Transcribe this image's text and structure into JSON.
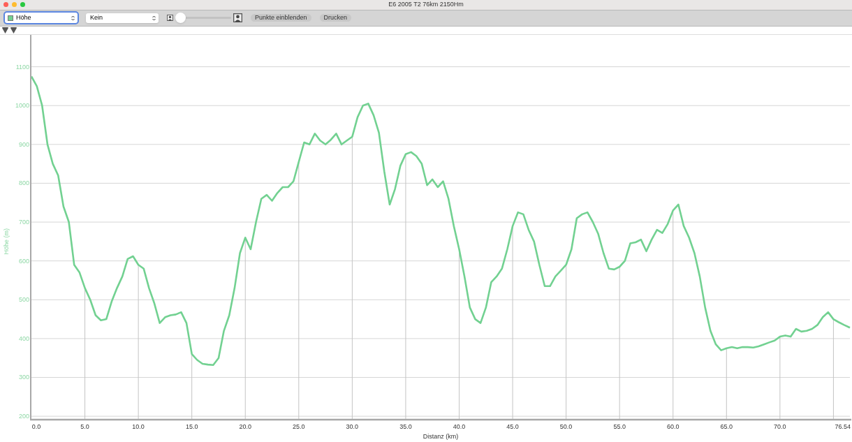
{
  "window": {
    "title": "E6 2005 T2 76km 2150Hm"
  },
  "toolbar": {
    "overlay_select": {
      "value": "Kein"
    },
    "zoom_slider": {
      "level": 0
    },
    "buttons": [
      "Punkte einblenden",
      "Drucken"
    ]
  },
  "chart": {
    "chart_data": {
      "type": "line",
      "grid": true,
      "ref_lines": [
        {
          "axis": "x",
          "value": 5
        },
        {
          "axis": "x",
          "value": 10
        },
        {
          "axis": "x",
          "value": 15
        },
        {
          "axis": "x",
          "value": 20
        },
        {
          "axis": "x",
          "value": 25
        },
        {
          "axis": "x",
          "value": 30
        },
        {
          "axis": "x",
          "value": 35
        },
        {
          "axis": "x",
          "value": 40
        },
        {
          "axis": "x",
          "value": 45
        },
        {
          "axis": "x",
          "value": 50
        },
        {
          "axis": "x",
          "value": 55
        },
        {
          "axis": "x",
          "value": 60
        },
        {
          "axis": "x",
          "value": 65
        },
        {
          "axis": "x",
          "value": 70
        },
        {
          "axis": "x",
          "value": 75
        }
      ],
      "xlabel": "Distanz (km)",
      "ylabel": "Höhe (m)",
      "xlim": [
        0,
        76.54
      ],
      "ylim": [
        193,
        1182
      ],
      "x": [
        0,
        0.5,
        1,
        1.5,
        2,
        2.5,
        3,
        3.5,
        4,
        4.5,
        5,
        5.5,
        6,
        6.5,
        7,
        7.5,
        8,
        8.5,
        9,
        9.5,
        10,
        10.5,
        11,
        11.5,
        12,
        12.5,
        13,
        13.5,
        14,
        14.5,
        15,
        15.5,
        16,
        16.5,
        17,
        17.5,
        18,
        18.5,
        19,
        19.5,
        20,
        20.5,
        21,
        21.5,
        22,
        22.5,
        23,
        23.5,
        24,
        24.5,
        25,
        25.5,
        26,
        26.5,
        27,
        27.5,
        28,
        28.5,
        29,
        29.5,
        30,
        30.5,
        31,
        31.5,
        32,
        32.5,
        33,
        33.5,
        34,
        34.5,
        35,
        35.5,
        36,
        36.5,
        37,
        37.5,
        38,
        38.5,
        39,
        39.5,
        40,
        40.5,
        41,
        41.5,
        42,
        42.5,
        43,
        43.5,
        44,
        44.5,
        45,
        45.5,
        46,
        46.5,
        47,
        47.5,
        48,
        48.5,
        49,
        49.5,
        50,
        50.5,
        51,
        51.5,
        52,
        52.5,
        53,
        53.5,
        54,
        54.5,
        55,
        55.5,
        56,
        56.5,
        57,
        57.5,
        58,
        58.5,
        59,
        59.5,
        60,
        60.5,
        61,
        61.5,
        62,
        62.5,
        63,
        63.5,
        64,
        64.5,
        65,
        65.5,
        66,
        66.5,
        67,
        67.5,
        68,
        68.5,
        69,
        69.5,
        70,
        70.5,
        71,
        71.5,
        72,
        72.5,
        73,
        73.5,
        74,
        74.5,
        75,
        75.5,
        76,
        76.54
      ],
      "series": [
        {
          "name": "Höhe",
          "color": "#72d191",
          "values": [
            1075,
            1050,
            1000,
            900,
            850,
            820,
            740,
            700,
            590,
            570,
            530,
            500,
            460,
            447,
            450,
            495,
            530,
            560,
            605,
            612,
            590,
            580,
            530,
            490,
            440,
            455,
            460,
            462,
            468,
            440,
            360,
            345,
            335,
            333,
            332,
            350,
            420,
            460,
            530,
            620,
            660,
            630,
            700,
            760,
            770,
            755,
            775,
            790,
            790,
            805,
            855,
            905,
            900,
            928,
            910,
            900,
            912,
            928,
            900,
            910,
            920,
            970,
            1000,
            1005,
            975,
            930,
            830,
            745,
            785,
            845,
            875,
            880,
            870,
            850,
            795,
            810,
            790,
            805,
            760,
            690,
            630,
            560,
            480,
            450,
            440,
            480,
            545,
            560,
            580,
            630,
            690,
            725,
            720,
            680,
            650,
            590,
            535,
            535,
            560,
            575,
            590,
            630,
            710,
            720,
            725,
            700,
            670,
            620,
            580,
            578,
            585,
            600,
            645,
            648,
            655,
            625,
            655,
            680,
            672,
            695,
            730,
            745,
            690,
            660,
            620,
            560,
            480,
            420,
            385,
            370,
            375,
            378,
            375,
            378,
            378,
            377,
            380,
            385,
            390,
            395,
            405,
            408,
            405,
            425,
            418,
            420,
            425,
            435,
            455,
            468,
            450,
            442,
            435,
            428
          ]
        }
      ],
      "xticks": [
        {
          "value": 0,
          "label": "0.0"
        },
        {
          "value": 5,
          "label": "5.0"
        },
        {
          "value": 10,
          "label": "10.0"
        },
        {
          "value": 15,
          "label": "15.0"
        },
        {
          "value": 20,
          "label": "20.0"
        },
        {
          "value": 25,
          "label": "25.0"
        },
        {
          "value": 30,
          "label": "30.0"
        },
        {
          "value": 35,
          "label": "35.0"
        },
        {
          "value": 40,
          "label": "40.0"
        },
        {
          "value": 45,
          "label": "45.0"
        },
        {
          "value": 50,
          "label": "50.0"
        },
        {
          "value": 55,
          "label": "55.0"
        },
        {
          "value": 60,
          "label": "60.0"
        },
        {
          "value": 65,
          "label": "65.0"
        },
        {
          "value": 70,
          "label": "70.0"
        },
        {
          "value": 76.54,
          "label": "76.54"
        }
      ],
      "yticks": [
        200,
        300,
        400,
        500,
        600,
        700,
        800,
        900,
        1000,
        1100
      ]
    }
  }
}
